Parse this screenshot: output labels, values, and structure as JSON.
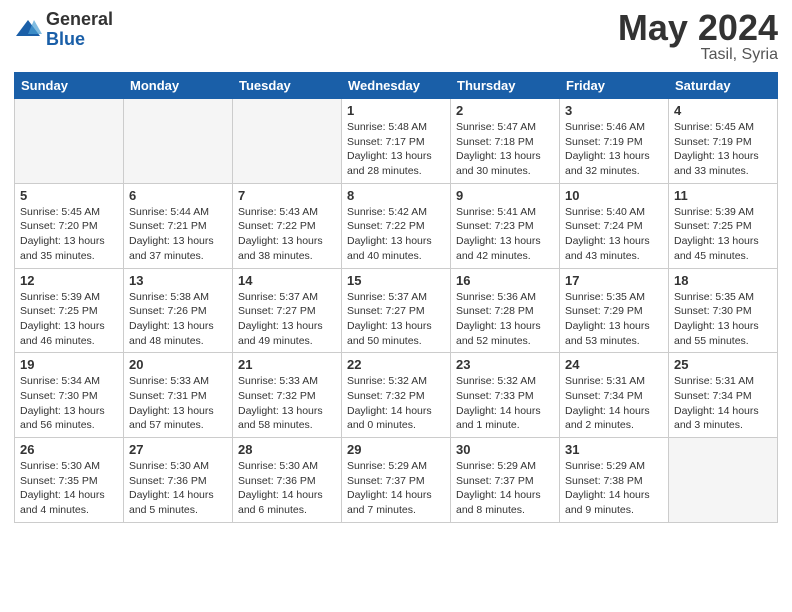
{
  "header": {
    "logo_general": "General",
    "logo_blue": "Blue",
    "month_title": "May 2024",
    "location": "Tasil, Syria"
  },
  "days_of_week": [
    "Sunday",
    "Monday",
    "Tuesday",
    "Wednesday",
    "Thursday",
    "Friday",
    "Saturday"
  ],
  "weeks": [
    [
      {
        "day": "",
        "empty": true
      },
      {
        "day": "",
        "empty": true
      },
      {
        "day": "",
        "empty": true
      },
      {
        "day": "1",
        "sunrise": "Sunrise: 5:48 AM",
        "sunset": "Sunset: 7:17 PM",
        "daylight": "Daylight: 13 hours and 28 minutes."
      },
      {
        "day": "2",
        "sunrise": "Sunrise: 5:47 AM",
        "sunset": "Sunset: 7:18 PM",
        "daylight": "Daylight: 13 hours and 30 minutes."
      },
      {
        "day": "3",
        "sunrise": "Sunrise: 5:46 AM",
        "sunset": "Sunset: 7:19 PM",
        "daylight": "Daylight: 13 hours and 32 minutes."
      },
      {
        "day": "4",
        "sunrise": "Sunrise: 5:45 AM",
        "sunset": "Sunset: 7:19 PM",
        "daylight": "Daylight: 13 hours and 33 minutes."
      }
    ],
    [
      {
        "day": "5",
        "sunrise": "Sunrise: 5:45 AM",
        "sunset": "Sunset: 7:20 PM",
        "daylight": "Daylight: 13 hours and 35 minutes."
      },
      {
        "day": "6",
        "sunrise": "Sunrise: 5:44 AM",
        "sunset": "Sunset: 7:21 PM",
        "daylight": "Daylight: 13 hours and 37 minutes."
      },
      {
        "day": "7",
        "sunrise": "Sunrise: 5:43 AM",
        "sunset": "Sunset: 7:22 PM",
        "daylight": "Daylight: 13 hours and 38 minutes."
      },
      {
        "day": "8",
        "sunrise": "Sunrise: 5:42 AM",
        "sunset": "Sunset: 7:22 PM",
        "daylight": "Daylight: 13 hours and 40 minutes."
      },
      {
        "day": "9",
        "sunrise": "Sunrise: 5:41 AM",
        "sunset": "Sunset: 7:23 PM",
        "daylight": "Daylight: 13 hours and 42 minutes."
      },
      {
        "day": "10",
        "sunrise": "Sunrise: 5:40 AM",
        "sunset": "Sunset: 7:24 PM",
        "daylight": "Daylight: 13 hours and 43 minutes."
      },
      {
        "day": "11",
        "sunrise": "Sunrise: 5:39 AM",
        "sunset": "Sunset: 7:25 PM",
        "daylight": "Daylight: 13 hours and 45 minutes."
      }
    ],
    [
      {
        "day": "12",
        "sunrise": "Sunrise: 5:39 AM",
        "sunset": "Sunset: 7:25 PM",
        "daylight": "Daylight: 13 hours and 46 minutes."
      },
      {
        "day": "13",
        "sunrise": "Sunrise: 5:38 AM",
        "sunset": "Sunset: 7:26 PM",
        "daylight": "Daylight: 13 hours and 48 minutes."
      },
      {
        "day": "14",
        "sunrise": "Sunrise: 5:37 AM",
        "sunset": "Sunset: 7:27 PM",
        "daylight": "Daylight: 13 hours and 49 minutes."
      },
      {
        "day": "15",
        "sunrise": "Sunrise: 5:37 AM",
        "sunset": "Sunset: 7:27 PM",
        "daylight": "Daylight: 13 hours and 50 minutes."
      },
      {
        "day": "16",
        "sunrise": "Sunrise: 5:36 AM",
        "sunset": "Sunset: 7:28 PM",
        "daylight": "Daylight: 13 hours and 52 minutes."
      },
      {
        "day": "17",
        "sunrise": "Sunrise: 5:35 AM",
        "sunset": "Sunset: 7:29 PM",
        "daylight": "Daylight: 13 hours and 53 minutes."
      },
      {
        "day": "18",
        "sunrise": "Sunrise: 5:35 AM",
        "sunset": "Sunset: 7:30 PM",
        "daylight": "Daylight: 13 hours and 55 minutes."
      }
    ],
    [
      {
        "day": "19",
        "sunrise": "Sunrise: 5:34 AM",
        "sunset": "Sunset: 7:30 PM",
        "daylight": "Daylight: 13 hours and 56 minutes."
      },
      {
        "day": "20",
        "sunrise": "Sunrise: 5:33 AM",
        "sunset": "Sunset: 7:31 PM",
        "daylight": "Daylight: 13 hours and 57 minutes."
      },
      {
        "day": "21",
        "sunrise": "Sunrise: 5:33 AM",
        "sunset": "Sunset: 7:32 PM",
        "daylight": "Daylight: 13 hours and 58 minutes."
      },
      {
        "day": "22",
        "sunrise": "Sunrise: 5:32 AM",
        "sunset": "Sunset: 7:32 PM",
        "daylight": "Daylight: 14 hours and 0 minutes."
      },
      {
        "day": "23",
        "sunrise": "Sunrise: 5:32 AM",
        "sunset": "Sunset: 7:33 PM",
        "daylight": "Daylight: 14 hours and 1 minute."
      },
      {
        "day": "24",
        "sunrise": "Sunrise: 5:31 AM",
        "sunset": "Sunset: 7:34 PM",
        "daylight": "Daylight: 14 hours and 2 minutes."
      },
      {
        "day": "25",
        "sunrise": "Sunrise: 5:31 AM",
        "sunset": "Sunset: 7:34 PM",
        "daylight": "Daylight: 14 hours and 3 minutes."
      }
    ],
    [
      {
        "day": "26",
        "sunrise": "Sunrise: 5:30 AM",
        "sunset": "Sunset: 7:35 PM",
        "daylight": "Daylight: 14 hours and 4 minutes."
      },
      {
        "day": "27",
        "sunrise": "Sunrise: 5:30 AM",
        "sunset": "Sunset: 7:36 PM",
        "daylight": "Daylight: 14 hours and 5 minutes."
      },
      {
        "day": "28",
        "sunrise": "Sunrise: 5:30 AM",
        "sunset": "Sunset: 7:36 PM",
        "daylight": "Daylight: 14 hours and 6 minutes."
      },
      {
        "day": "29",
        "sunrise": "Sunrise: 5:29 AM",
        "sunset": "Sunset: 7:37 PM",
        "daylight": "Daylight: 14 hours and 7 minutes."
      },
      {
        "day": "30",
        "sunrise": "Sunrise: 5:29 AM",
        "sunset": "Sunset: 7:37 PM",
        "daylight": "Daylight: 14 hours and 8 minutes."
      },
      {
        "day": "31",
        "sunrise": "Sunrise: 5:29 AM",
        "sunset": "Sunset: 7:38 PM",
        "daylight": "Daylight: 14 hours and 9 minutes."
      },
      {
        "day": "",
        "empty": true
      }
    ]
  ]
}
